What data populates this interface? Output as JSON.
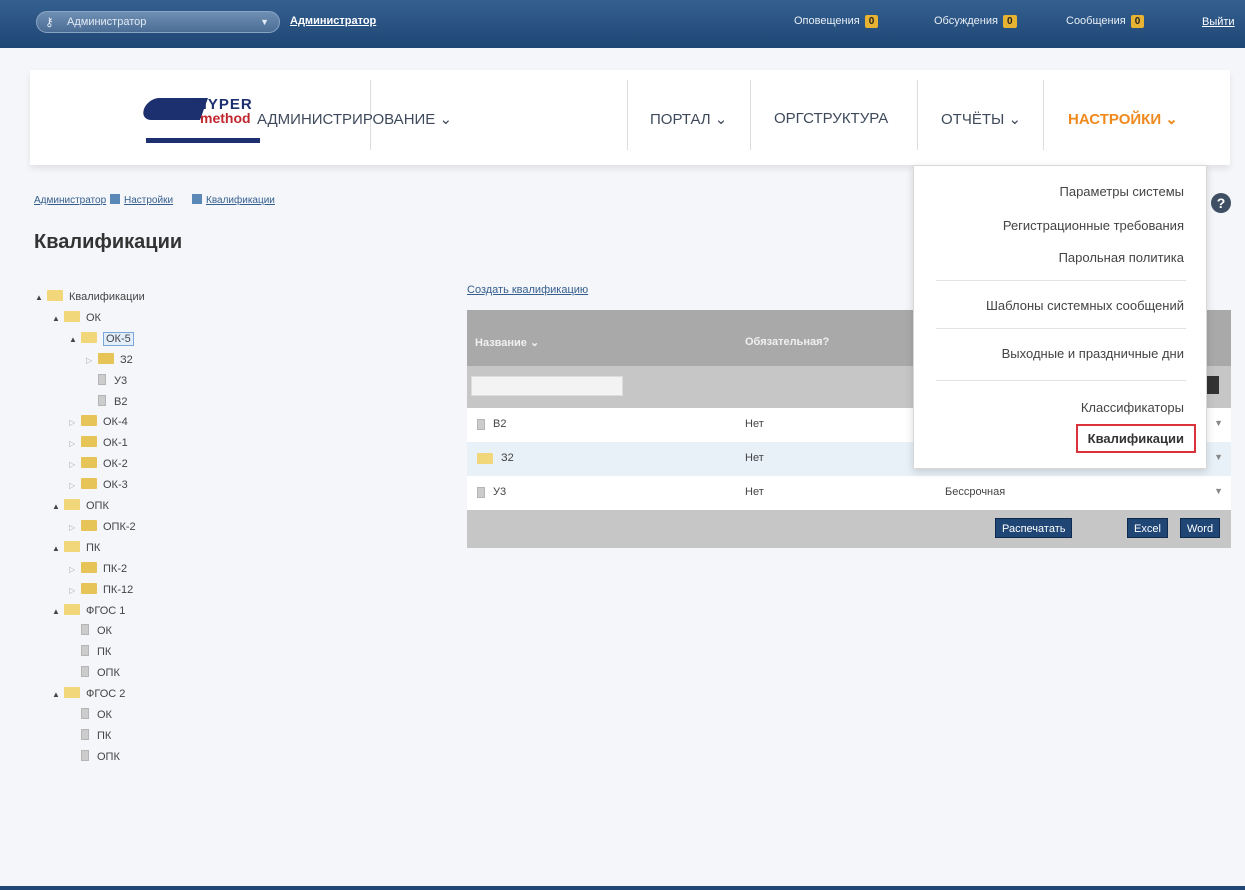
{
  "topbar": {
    "role": "Администратор",
    "user_link": "Администратор",
    "notifications_label": "Оповещения",
    "notifications_count": "0",
    "discussions_label": "Обсуждения",
    "discussions_count": "0",
    "messages_label": "Сообщения",
    "messages_count": "0",
    "logout": "Выйти"
  },
  "logo": {
    "word1": "HYPER",
    "word2": "method"
  },
  "menu": {
    "admin": "АДМИНИСТРИРОВАНИЕ ⌄",
    "portal": "ПОРТАЛ ⌄",
    "org": "ОРГСТРУКТУРА",
    "reports": "ОТЧЁТЫ ⌄",
    "settings": "НАСТРОЙКИ ⌄"
  },
  "breadcrumb": [
    "Администратор",
    "Настройки",
    "Квалификации"
  ],
  "page_title": "Квалификации",
  "tree": [
    {
      "label": "Квалификации",
      "level": 0,
      "type": "folder",
      "tri": "▲"
    },
    {
      "label": "ОК",
      "level": 1,
      "type": "folder",
      "tri": "▲"
    },
    {
      "label": "ОК-5",
      "level": 2,
      "type": "folder",
      "tri": "▲",
      "selected": true
    },
    {
      "label": "З2",
      "level": 3,
      "type": "folder-closed",
      "tri": "▷"
    },
    {
      "label": "У3",
      "level": 3,
      "type": "doc",
      "tri": ""
    },
    {
      "label": "В2",
      "level": 3,
      "type": "doc",
      "tri": ""
    },
    {
      "label": "ОК-4",
      "level": 2,
      "type": "folder-closed",
      "tri": "▷"
    },
    {
      "label": "ОК-1",
      "level": 2,
      "type": "folder-closed",
      "tri": "▷"
    },
    {
      "label": "ОК-2",
      "level": 2,
      "type": "folder-closed",
      "tri": "▷"
    },
    {
      "label": "ОК-3",
      "level": 2,
      "type": "folder-closed",
      "tri": "▷"
    },
    {
      "label": "ОПК",
      "level": 1,
      "type": "folder",
      "tri": "▲"
    },
    {
      "label": "ОПК-2",
      "level": 2,
      "type": "folder-closed",
      "tri": "▷"
    },
    {
      "label": "ПК",
      "level": 1,
      "type": "folder",
      "tri": "▲"
    },
    {
      "label": "ПК-2",
      "level": 2,
      "type": "folder-closed",
      "tri": "▷"
    },
    {
      "label": "ПК-12",
      "level": 2,
      "type": "folder-closed",
      "tri": "▷"
    },
    {
      "label": "ФГОС 1",
      "level": 1,
      "type": "folder",
      "tri": "▲"
    },
    {
      "label": "ОК",
      "level": 2,
      "type": "doc",
      "tri": ""
    },
    {
      "label": "ПК",
      "level": 2,
      "type": "doc",
      "tri": ""
    },
    {
      "label": "ОПК",
      "level": 2,
      "type": "doc",
      "tri": ""
    },
    {
      "label": "ФГОС 2",
      "level": 1,
      "type": "folder",
      "tri": "▲"
    },
    {
      "label": "ОК",
      "level": 2,
      "type": "doc",
      "tri": ""
    },
    {
      "label": "ПК",
      "level": 2,
      "type": "doc",
      "tri": ""
    },
    {
      "label": "ОПК",
      "level": 2,
      "type": "doc",
      "tri": ""
    }
  ],
  "create_link": "Создать квалификацию",
  "grid": {
    "columns": [
      "Название ⌄",
      "Обязательная?"
    ],
    "rows": [
      {
        "name": "В2",
        "required": "Нет",
        "period": "",
        "icon": "doc"
      },
      {
        "name": "З2",
        "required": "Нет",
        "period": "",
        "icon": "folder"
      },
      {
        "name": "У3",
        "required": "Нет",
        "period": "Бессрочная",
        "icon": "doc"
      }
    ],
    "buttons": [
      "Распечатать",
      "Excel",
      "Word"
    ]
  },
  "dropdown": {
    "items": [
      "Параметры системы",
      "Регистрационные требования",
      "Парольная политика",
      "Шаблоны системных сообщений",
      "Выходные и праздничные дни",
      "Классификаторы",
      "Квалификации"
    ]
  },
  "help": "?",
  "colors": {
    "topbar": "#1f4675",
    "accent": "#f08a1e",
    "highlight": "#d9323a"
  }
}
